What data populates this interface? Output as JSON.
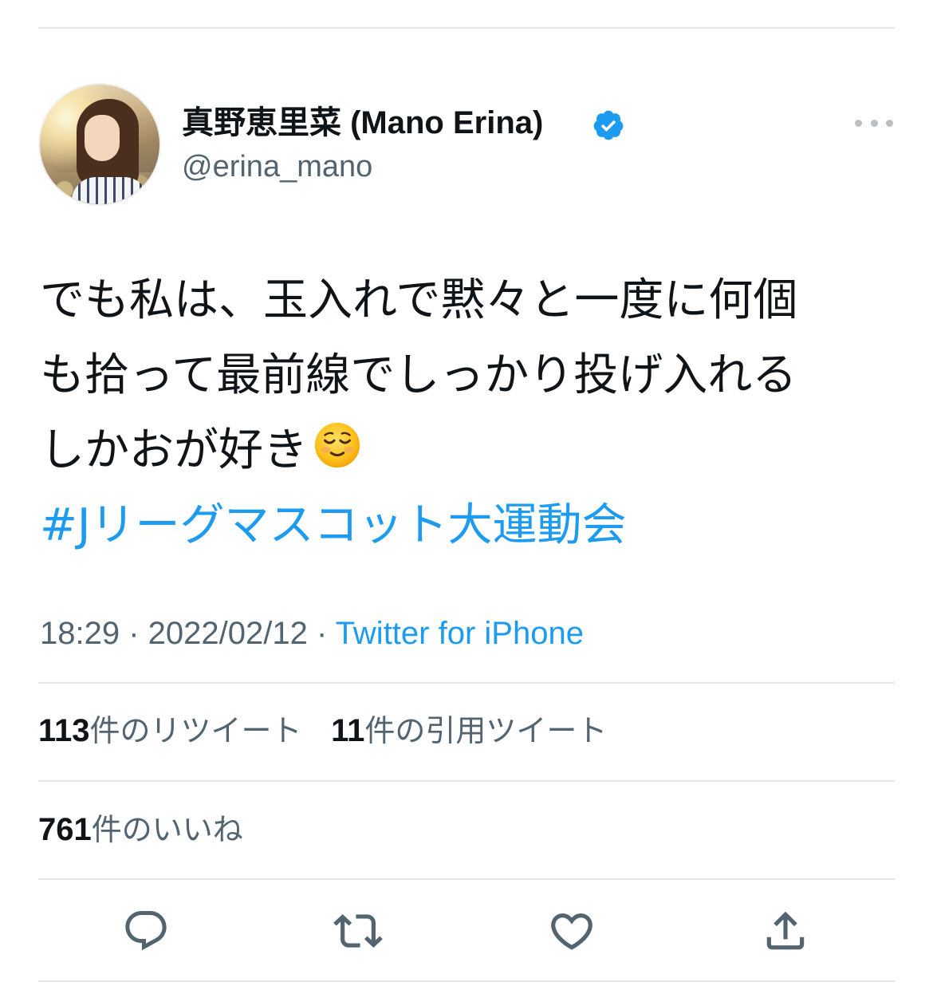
{
  "tweet": {
    "author": {
      "display_name": "真野恵里菜 (Mano Erina)",
      "handle": "@erina_mano",
      "verified": true
    },
    "text_lines": [
      "でも私は、玉入れで黙々と一度に何個",
      "も拾って最前線でしっかり投げ入れる",
      "しかおが好き"
    ],
    "emoji": "smiling-face-emoji",
    "hashtag": "#Jリーグマスコット大運動会",
    "time": "18:29",
    "date": "2022/02/12",
    "separator": " · ",
    "source": "Twitter for iPhone"
  },
  "stats": {
    "retweets": {
      "count": "113",
      "label": "件のリツイート"
    },
    "quotes": {
      "count": "11",
      "label": "件の引用ツイート"
    },
    "likes": {
      "count": "761",
      "label": "件のいいね"
    }
  },
  "actions": {
    "icons": [
      "reply-icon",
      "retweet-icon",
      "like-icon",
      "share-icon"
    ]
  },
  "colors": {
    "accent": "#1d9bf0",
    "text": "#0f1419",
    "secondary": "#536471",
    "divider": "#e6e6e6"
  }
}
